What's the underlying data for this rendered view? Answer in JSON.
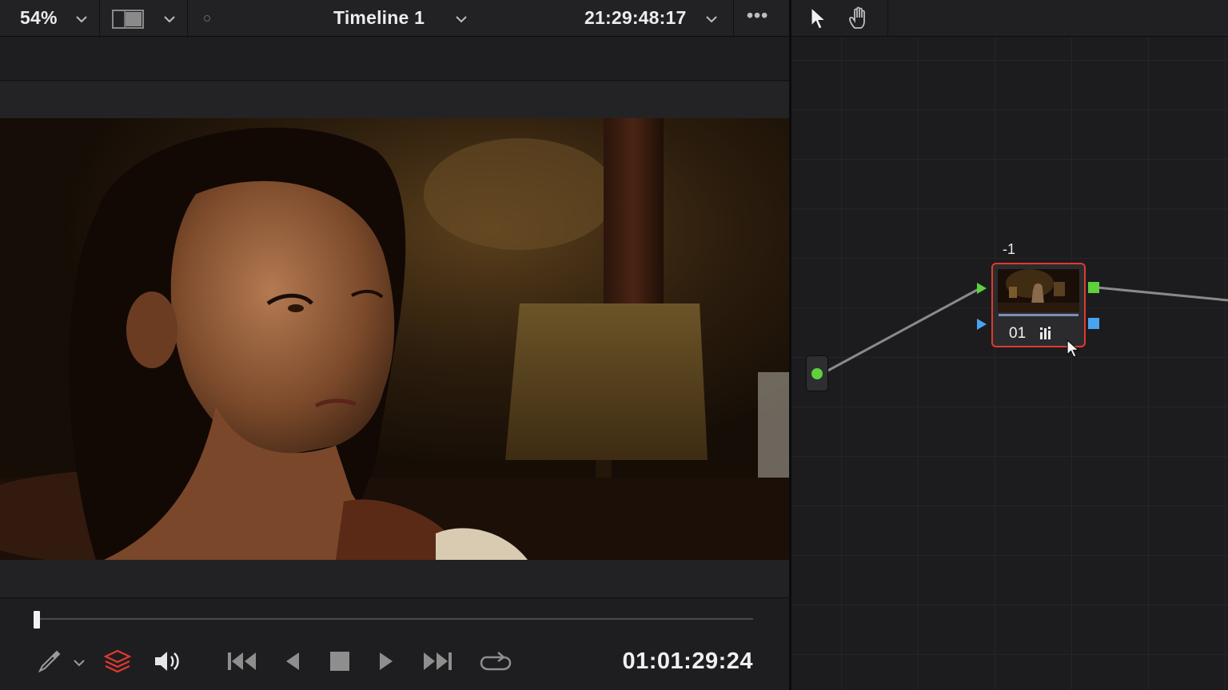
{
  "viewer": {
    "zoom": "54%",
    "timeline_name": "Timeline 1",
    "source_timecode": "21:29:48:17",
    "more_label": "•••",
    "playhead_position": 0.0,
    "record_timecode": "01:01:29:24"
  },
  "node_editor": {
    "node_label": "-1",
    "node_number": "01"
  },
  "icons": {
    "zoom_dropdown": "chevron-down-icon",
    "layout": "split-view-icon",
    "timeline_dropdown": "chevron-down-icon",
    "timecode_dropdown": "chevron-down-icon",
    "pointer": "pointer-icon",
    "hand": "hand-icon",
    "picker": "eyedropper-icon",
    "layers": "layers-icon",
    "volume": "speaker-icon",
    "go_start": "skip-to-start-icon",
    "step_back": "step-back-icon",
    "stop": "stop-icon",
    "play": "play-icon",
    "go_end": "skip-to-end-icon",
    "loop": "loop-icon",
    "histogram": "histogram-icon"
  },
  "colors": {
    "node_selected_border": "#e0392f",
    "rgb_port": "#5fd13c",
    "key_port": "#4aa3f0",
    "layers_active": "#e0392f"
  }
}
